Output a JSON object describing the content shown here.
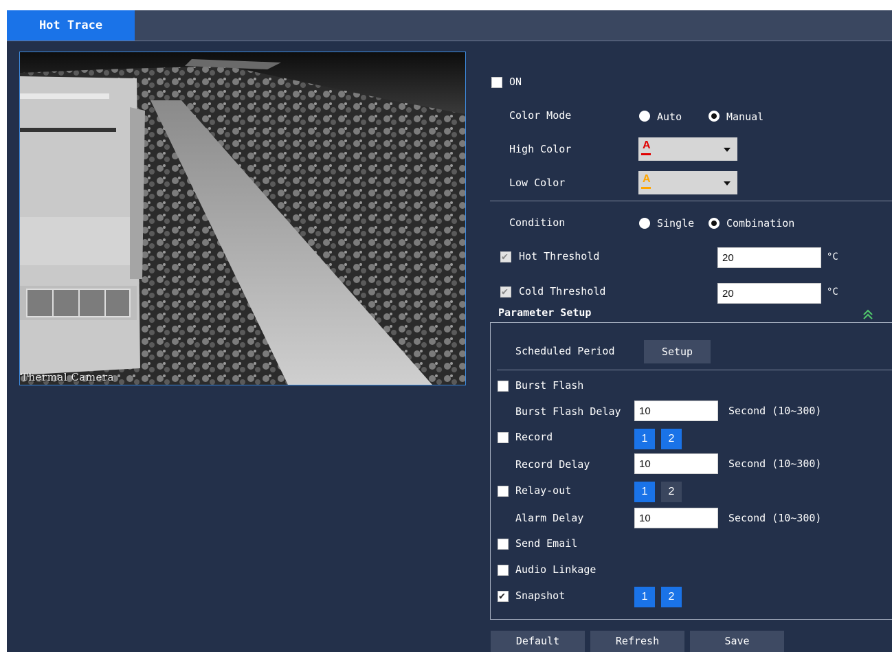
{
  "tabs": {
    "active": "Hot Trace"
  },
  "video": {
    "overlay": "Thermal Camera"
  },
  "settings": {
    "on_label": "ON",
    "on_checked": false,
    "color_mode": {
      "label": "Color Mode",
      "options": [
        "Auto",
        "Manual"
      ],
      "selected": "Manual"
    },
    "high_color": {
      "label": "High Color",
      "value": "A",
      "color": "#e00000"
    },
    "low_color": {
      "label": "Low Color",
      "value": "A",
      "color": "#ffa500"
    },
    "condition": {
      "label": "Condition",
      "options": [
        "Single",
        "Combination"
      ],
      "selected": "Combination"
    },
    "hot_threshold": {
      "label": "Hot Threshold",
      "value": "20",
      "unit": "°C",
      "checked": true
    },
    "cold_threshold": {
      "label": "Cold Threshold",
      "value": "20",
      "unit": "°C",
      "checked": true
    }
  },
  "parameter_setup": {
    "title": "Parameter Setup",
    "scheduled_period": {
      "label": "Scheduled Period",
      "button": "Setup"
    },
    "burst_flash": {
      "label": "Burst Flash",
      "checked": false
    },
    "burst_flash_delay": {
      "label": "Burst Flash Delay",
      "value": "10",
      "unit": "Second (10~300)"
    },
    "record": {
      "label": "Record",
      "checked": false,
      "channels": [
        "1",
        "2"
      ],
      "active": [
        true,
        true
      ]
    },
    "record_delay": {
      "label": "Record Delay",
      "value": "10",
      "unit": "Second (10~300)"
    },
    "relay_out": {
      "label": "Relay-out",
      "checked": false,
      "channels": [
        "1",
        "2"
      ],
      "active": [
        true,
        false
      ]
    },
    "alarm_delay": {
      "label": "Alarm Delay",
      "value": "10",
      "unit": "Second (10~300)"
    },
    "send_email": {
      "label": "Send Email",
      "checked": false
    },
    "audio_linkage": {
      "label": "Audio Linkage",
      "checked": false
    },
    "snapshot": {
      "label": "Snapshot",
      "checked": true,
      "channels": [
        "1",
        "2"
      ],
      "active": [
        true,
        true
      ]
    }
  },
  "buttons": {
    "default": "Default",
    "refresh": "Refresh",
    "save": "Save"
  },
  "colors": {
    "accent": "#1a73e8",
    "panel": "#23304a",
    "tabbar": "#3a4760"
  }
}
